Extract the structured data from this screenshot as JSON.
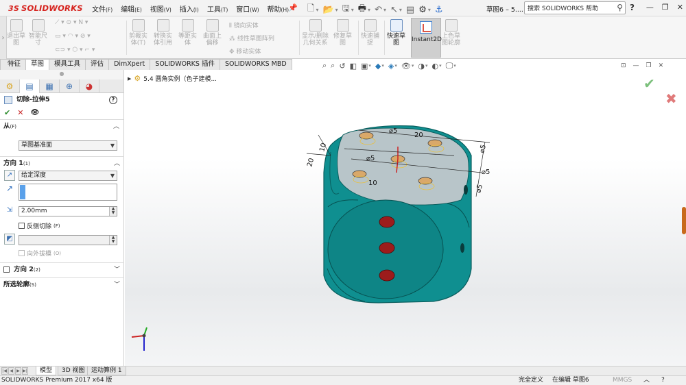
{
  "app": {
    "logo_symbol": "3S",
    "logo_text": "SOLIDWORKS",
    "document_title": "草图6 – 5....",
    "search_placeholder": "搜索 SOLIDWORKS 帮助",
    "help_label": "?"
  },
  "menu": [
    {
      "label": "文件",
      "key": "(F)"
    },
    {
      "label": "编辑",
      "key": "(E)"
    },
    {
      "label": "视图",
      "key": "(V)"
    },
    {
      "label": "插入",
      "key": "(I)"
    },
    {
      "label": "工具",
      "key": "(T)"
    },
    {
      "label": "窗口",
      "key": "(W)"
    },
    {
      "label": "帮助",
      "key": "(H)"
    }
  ],
  "command_manager": {
    "buttons": [
      {
        "label1": "退出草",
        "label2": "图"
      },
      {
        "label1": "智能尺",
        "label2": "寸"
      },
      {
        "label1": "剪裁实",
        "label2": "体(T)"
      },
      {
        "label1": "转换实",
        "label2": "体引用"
      },
      {
        "label1": "等距实",
        "label2": "体"
      },
      {
        "label1": "曲面上",
        "label2": "偏移"
      },
      {
        "label1": "显示/删除",
        "label2": "几何关系"
      },
      {
        "label1": "修复草",
        "label2": "图"
      },
      {
        "label1": "快速捕",
        "label2": "捉"
      },
      {
        "label1": "快速草",
        "label2": "图"
      },
      {
        "label1": "上色草",
        "label2": "图轮廓"
      }
    ],
    "small_items": [
      "镜向实体",
      "线性草图阵列",
      "移动实体"
    ],
    "instant2d_label": "Instant2D"
  },
  "tabs": [
    "特征",
    "草图",
    "模具工具",
    "评估",
    "DimXpert",
    "SOLIDWORKS 插件",
    "SOLIDWORKS MBD"
  ],
  "tree": {
    "item_label": "5.4 圆角实例（色子建模..."
  },
  "property_manager": {
    "title": "切除-拉伸5",
    "help_icon": "?",
    "ok": "✔",
    "cancel": "✕",
    "from": {
      "label": "从",
      "key": "(F)",
      "value": "草图基准面"
    },
    "direction1": {
      "label": "方向 1",
      "key": "(1)",
      "end_condition": "给定深度",
      "depth": "2.00mm",
      "flip_side_label": "反侧切除",
      "flip_side_key": "(F)",
      "draft_outward_label": "向外拔模",
      "draft_outward_key": "(O)"
    },
    "direction2": {
      "label": "方向 2",
      "key": "(2)"
    },
    "selected_contours": {
      "label": "所选轮廓",
      "key": "(S)"
    }
  },
  "model_dims": [
    "10",
    "20",
    "⌀5",
    "20",
    "⌀5",
    "⌀5",
    "⌀5",
    "⌀5",
    "10"
  ],
  "bottom_tabs": [
    "模型",
    "3D 视图",
    "运动算例 1"
  ],
  "status": {
    "product": "SOLIDWORKS Premium 2017 x64 版",
    "definition": "完全定义",
    "editing": "在编辑 草图6",
    "units": "MMGS"
  },
  "colors": {
    "die_body": "#0f8f90",
    "die_face_top": "#b8c5c9",
    "pip_red": "#9c1c1c",
    "accent_blue": "#2a6ccd",
    "logo_red": "#d6241f"
  }
}
